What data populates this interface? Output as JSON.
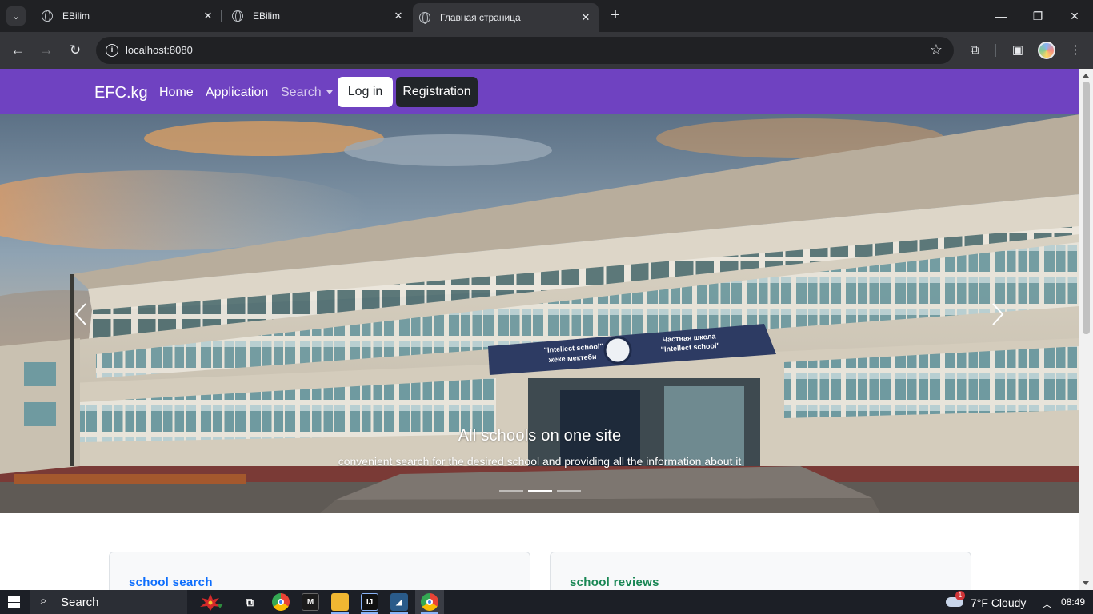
{
  "browser": {
    "tabs": [
      {
        "title": "EBilim"
      },
      {
        "title": "EBilim"
      },
      {
        "title": "Главная страница"
      }
    ],
    "url": "localhost:8080"
  },
  "site": {
    "brand": "EFC.kg",
    "nav": {
      "home": "Home",
      "application": "Application",
      "search": "Search",
      "login": "Log in",
      "registration": "Registration"
    },
    "carousel": {
      "title": "All schools on one site",
      "subtitle": "convenient search for the desired school and providing all the information about it",
      "slide_count": 3,
      "active_slide": 2,
      "sign_left_line1": "\"Intellect school\"",
      "sign_left_line2": "жеке мектеби",
      "sign_right_line1": "Частная школа",
      "sign_right_line2": "\"Intellect school\""
    },
    "cards": [
      {
        "title": "school search"
      },
      {
        "title": "school reviews"
      }
    ]
  },
  "taskbar": {
    "search_label": "Search",
    "weather": "7°F  Cloudy",
    "weather_badge": "1",
    "time": "08:49"
  }
}
